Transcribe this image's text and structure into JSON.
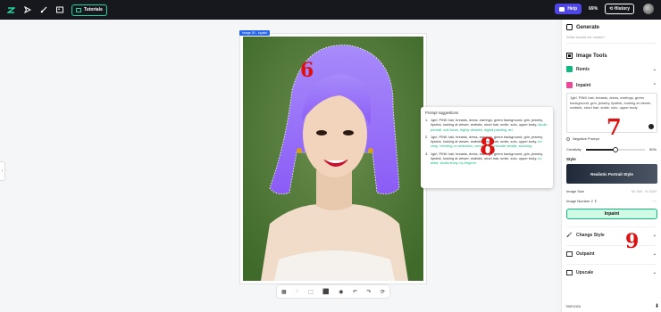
{
  "topbar": {
    "tutorials_label": "Tutorials",
    "help_label": "Help",
    "zoom": "69%",
    "history_label": "History"
  },
  "canvas": {
    "image_tag": "Image 00 - Inpaint"
  },
  "suggestions": {
    "title": "Prompt suggestions",
    "items": [
      {
        "num": "1.",
        "text": "1girl, PINK hair, breasts, dress, earrings, green background, grin, jewelry, lipstick, looking at viewer, realistic, short hair, smile, solo, upper body,",
        "extra": " studio portrait, soft focus, highly detailed, digital painting, art"
      },
      {
        "num": "2.",
        "text": "1girl, PINK hair, breasts, dress, earrings, green background, grin, jewelry, lipstick, looking at viewer, realistic, short hair, smile, solo, upper body,",
        "extra": " hd crisp, trending on artstation, concept art, intricate details, stunning"
      },
      {
        "num": "3.",
        "text": "1girl, PINK hair, breasts, dress, earrings, green background, grin, jewelry, lipstick, looking at viewer, realistic, short hair, smile, solo, upper body,",
        "extra": " no artist, studio body, by Artgerm"
      }
    ]
  },
  "panel": {
    "generate_title": "Generate",
    "prompt_placeholder": "What should we create?",
    "image_tools_title": "Image Tools",
    "remix_label": "Remix",
    "inpaint_label": "Inpaint",
    "prompt_text": "1girl, PINK hair, breasts, dress, earrings, green background, grin, jewelry, lipstick, looking at viewer, realistic, short hair, smile, solo, upper body",
    "negative_prompt_label": "Negative Prompt",
    "creativity_label": "Creativity",
    "creativity_value": "50%",
    "creativity_level": 0.5,
    "style_label": "Style",
    "style_name": "Realistic Portrait Style",
    "image_size_label": "Image Size",
    "width_label": "W",
    "width_value": "768",
    "height_label": "H",
    "height_value": "1024",
    "image_number_label": "Image Number",
    "image_number_value": "2",
    "inpaint_button": "Inpaint",
    "change_style_label": "Change Style",
    "outpaint_label": "Outpaint",
    "upscale_label": "Upscale",
    "footer_size": "768*1024"
  },
  "annotations": {
    "a6": "6",
    "a7": "7",
    "a8": "8",
    "a9": "9"
  },
  "colors": {
    "accent": "#10b981",
    "help": "#4f46e5",
    "mask": "#8b5cf6",
    "annotation": "#dd1111"
  }
}
